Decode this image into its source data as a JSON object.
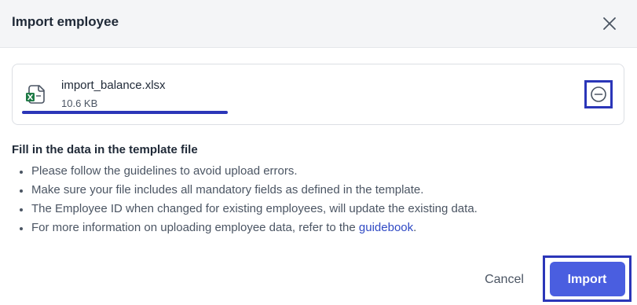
{
  "dialog": {
    "title": "Import employee"
  },
  "file": {
    "name": "import_balance.xlsx",
    "size": "10.6 KB",
    "upload_progress": 1.0,
    "icon": "excel-file-icon"
  },
  "instructions": {
    "heading": "Fill in the data in the template file",
    "items": [
      {
        "text": "Please follow the guidelines to avoid upload errors."
      },
      {
        "text": "Make sure your file includes all mandatory fields as defined in the template."
      },
      {
        "text": "The Employee ID when changed for existing employees, will update the existing data."
      },
      {
        "text": "For more information on uploading employee data, refer to the ",
        "link": "guidebook",
        "suffix": "."
      }
    ]
  },
  "actions": {
    "cancel_label": "Cancel",
    "import_label": "Import"
  },
  "colors": {
    "accent": "#4a5ee0",
    "highlight": "#2b36b8",
    "link": "#2f49c4",
    "excel_green": "#1d7a45"
  }
}
